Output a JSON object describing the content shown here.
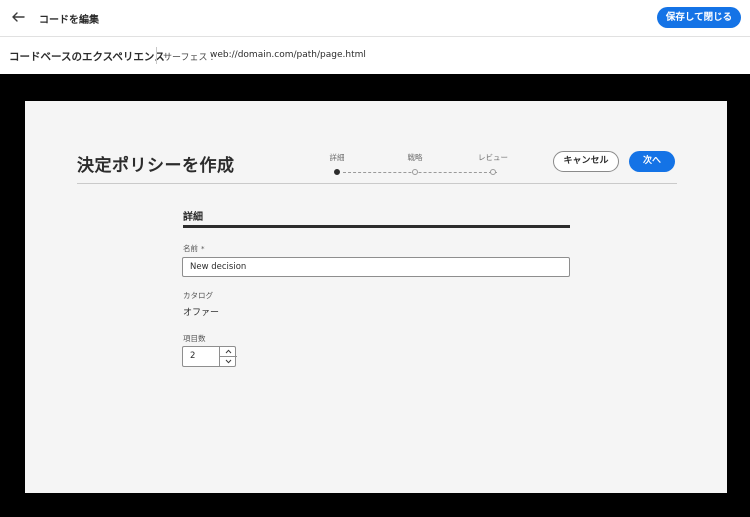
{
  "topbar": {
    "back_icon": "arrow-left-icon",
    "title": "コードを編集",
    "save_close_label": "保存して閉じる"
  },
  "subheader": {
    "experience_title": "コードベースのエクスペリエンス",
    "surface_label": "サーフェス :",
    "surface_value": "web://domain.com/path/page.html"
  },
  "dialog": {
    "title": "決定ポリシーを作成",
    "steps": [
      {
        "label": "詳細",
        "active": true
      },
      {
        "label": "戦略",
        "active": false
      },
      {
        "label": "レビュー",
        "active": false
      }
    ],
    "cancel_label": "キャンセル",
    "next_label": "次へ"
  },
  "form": {
    "section_title": "詳細",
    "name_label": "名前",
    "name_required_mark": "*",
    "name_value": "New decision",
    "catalog_label": "カタログ",
    "catalog_value": "オファー",
    "item_count_label": "項目数",
    "item_count_value": "2"
  },
  "colors": {
    "accent": "#1473e6",
    "stage_background": "#000000",
    "panel_background": "#f5f5f5"
  }
}
